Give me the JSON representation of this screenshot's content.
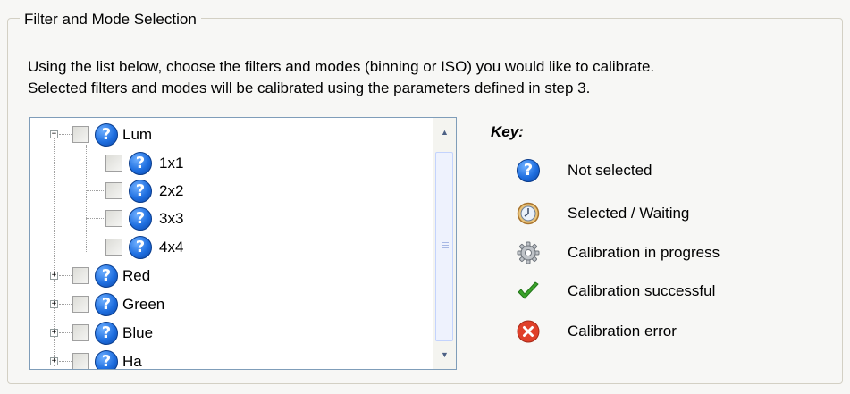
{
  "group": {
    "title": "Filter and Mode Selection",
    "intro_line1": "Using the list below, choose the filters and modes (binning or ISO) you would like to calibrate.",
    "intro_line2": "Selected filters and modes will be calibrated using the parameters defined in step 3."
  },
  "tree": {
    "items": [
      {
        "label": "Lum",
        "level": 0,
        "expanded": true
      },
      {
        "label": "1x1",
        "level": 1
      },
      {
        "label": "2x2",
        "level": 1
      },
      {
        "label": "3x3",
        "level": 1
      },
      {
        "label": "4x4",
        "level": 1
      },
      {
        "label": "Red",
        "level": 0,
        "expanded": false
      },
      {
        "label": "Green",
        "level": 0,
        "expanded": false
      },
      {
        "label": "Blue",
        "level": 0,
        "expanded": false
      },
      {
        "label": "Ha",
        "level": 0,
        "expanded": false
      }
    ]
  },
  "key": {
    "title": "Key:",
    "items": [
      {
        "label": "Not selected",
        "icon": "question-icon"
      },
      {
        "label": "Selected / Waiting",
        "icon": "clock-icon"
      },
      {
        "label": "Calibration in progress",
        "icon": "gear-icon"
      },
      {
        "label": "Calibration successful",
        "icon": "checkmark-icon"
      },
      {
        "label": "Calibration error",
        "icon": "error-icon"
      }
    ]
  },
  "colors": {
    "question_blue": "#1f6fe0",
    "success_green": "#3aa32a",
    "error_red": "#e0402a"
  }
}
